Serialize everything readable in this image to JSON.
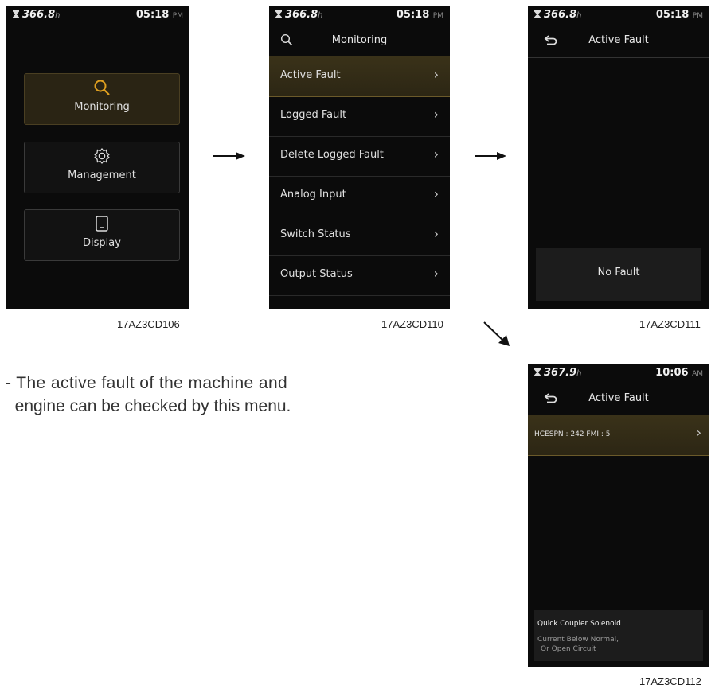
{
  "screens": {
    "s1": {
      "hours_value": "366.8",
      "hours_unit": "h",
      "time": "05:18",
      "ampm": "PM",
      "tiles": [
        {
          "label": "Monitoring"
        },
        {
          "label": "Management"
        },
        {
          "label": "Display"
        }
      ],
      "caption": "17AZ3CD106"
    },
    "s2": {
      "hours_value": "366.8",
      "hours_unit": "h",
      "time": "05:18",
      "ampm": "PM",
      "title": "Monitoring",
      "items": [
        {
          "label": "Active Fault"
        },
        {
          "label": "Logged Fault"
        },
        {
          "label": "Delete Logged Fault"
        },
        {
          "label": "Analog Input"
        },
        {
          "label": "Switch Status"
        },
        {
          "label": "Output Status"
        }
      ],
      "caption": "17AZ3CD110"
    },
    "s3": {
      "hours_value": "366.8",
      "hours_unit": "h",
      "time": "05:18",
      "ampm": "PM",
      "title": "Active Fault",
      "message": "No Fault",
      "caption": "17AZ3CD111"
    },
    "s4": {
      "hours_value": "367.9",
      "hours_unit": "h",
      "time": "10:06",
      "ampm": "AM",
      "title": "Active Fault",
      "fault_row": "HCESPN : 242  FMI : 5",
      "detail_title": "Quick Coupler Solenoid",
      "detail_line1": "Current Below Normal,",
      "detail_line2": "Or Open Circuit",
      "caption": "17AZ3CD112"
    }
  },
  "description": {
    "line1": "- The active fault of the machine and",
    "line2": "  engine can be checked by this menu."
  },
  "colors": {
    "accent": "#e0a020",
    "screen_bg": "#0b0b0b",
    "selected_row": "#3a3219"
  }
}
